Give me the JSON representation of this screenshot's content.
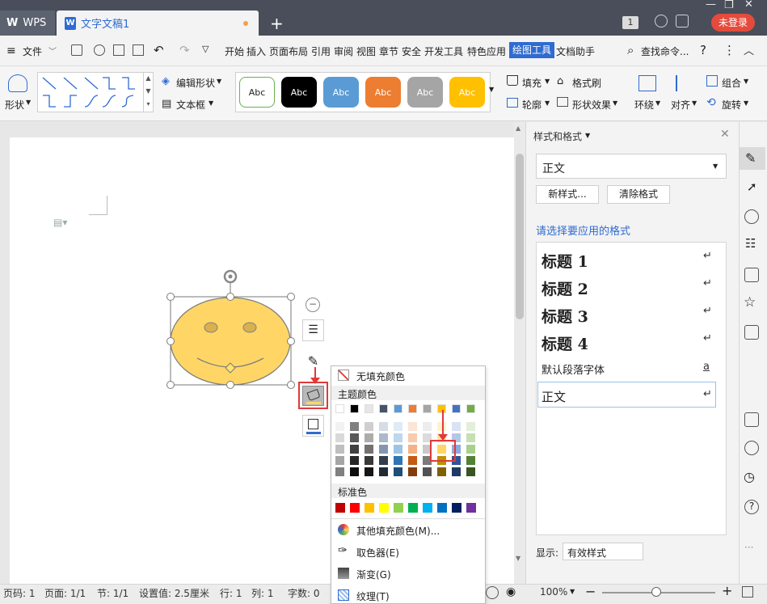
{
  "titlebar": {
    "app_tab": "WPS",
    "doc_tab": "文字文稿1",
    "new_tab_glyph": "+",
    "window_badge": "1",
    "login": "未登录"
  },
  "menu": {
    "file": "文件",
    "items": [
      "开始",
      "插入",
      "页面布局",
      "引用",
      "审阅",
      "视图",
      "章节",
      "安全",
      "开发工具",
      "特色应用"
    ],
    "active": "绘图工具",
    "doc_helper": "文档助手",
    "search": "查找命令..."
  },
  "ribbon": {
    "shape": "形状",
    "edit_shape": "编辑形状",
    "text_box": "文本框",
    "styles": [
      "Abc",
      "Abc",
      "Abc",
      "Abc",
      "Abc",
      "Abc"
    ],
    "fill": "填充",
    "format_painter": "格式刷",
    "outline": "轮廓",
    "shape_effect": "形状效果",
    "wrap": "环绕",
    "align": "对齐",
    "group": "组合",
    "rotate": "旋转"
  },
  "panel": {
    "title": "样式和格式",
    "current_style": "正文",
    "new_style": "新样式...",
    "clear_format": "清除格式",
    "apply_label": "请选择要应用的格式",
    "styles": [
      {
        "label": "标题  1",
        "mark": "↵"
      },
      {
        "label": "标题  2",
        "mark": "↵"
      },
      {
        "label": "标题  3",
        "mark": "↵"
      },
      {
        "label": "标题  4",
        "mark": "↵"
      },
      {
        "label": "默认段落字体",
        "mark": "a"
      },
      {
        "label": "正文",
        "mark": "↵"
      }
    ],
    "display_label": "显示:",
    "display_value": "有效样式"
  },
  "dropdown": {
    "no_fill": "无填充颜色",
    "theme_header": "主题颜色",
    "standard_header": "标准色",
    "more_colors": "其他填充颜色(M)...",
    "picker": "取色器(E)",
    "gradient": "渐变(G)",
    "texture": "纹理(T)"
  },
  "status": {
    "page_num": "页码: 1",
    "pages": "页面: 1/1",
    "section": "节: 1/1",
    "setting": "设置值: 2.5厘米",
    "row": "行: 1",
    "col": "列: 1",
    "words": "字数: 0",
    "zoom": "100%"
  },
  "colors": {
    "accent": "#2f6bd1",
    "shape_fill": "#ffd666",
    "highlight": "#e03a3a"
  }
}
